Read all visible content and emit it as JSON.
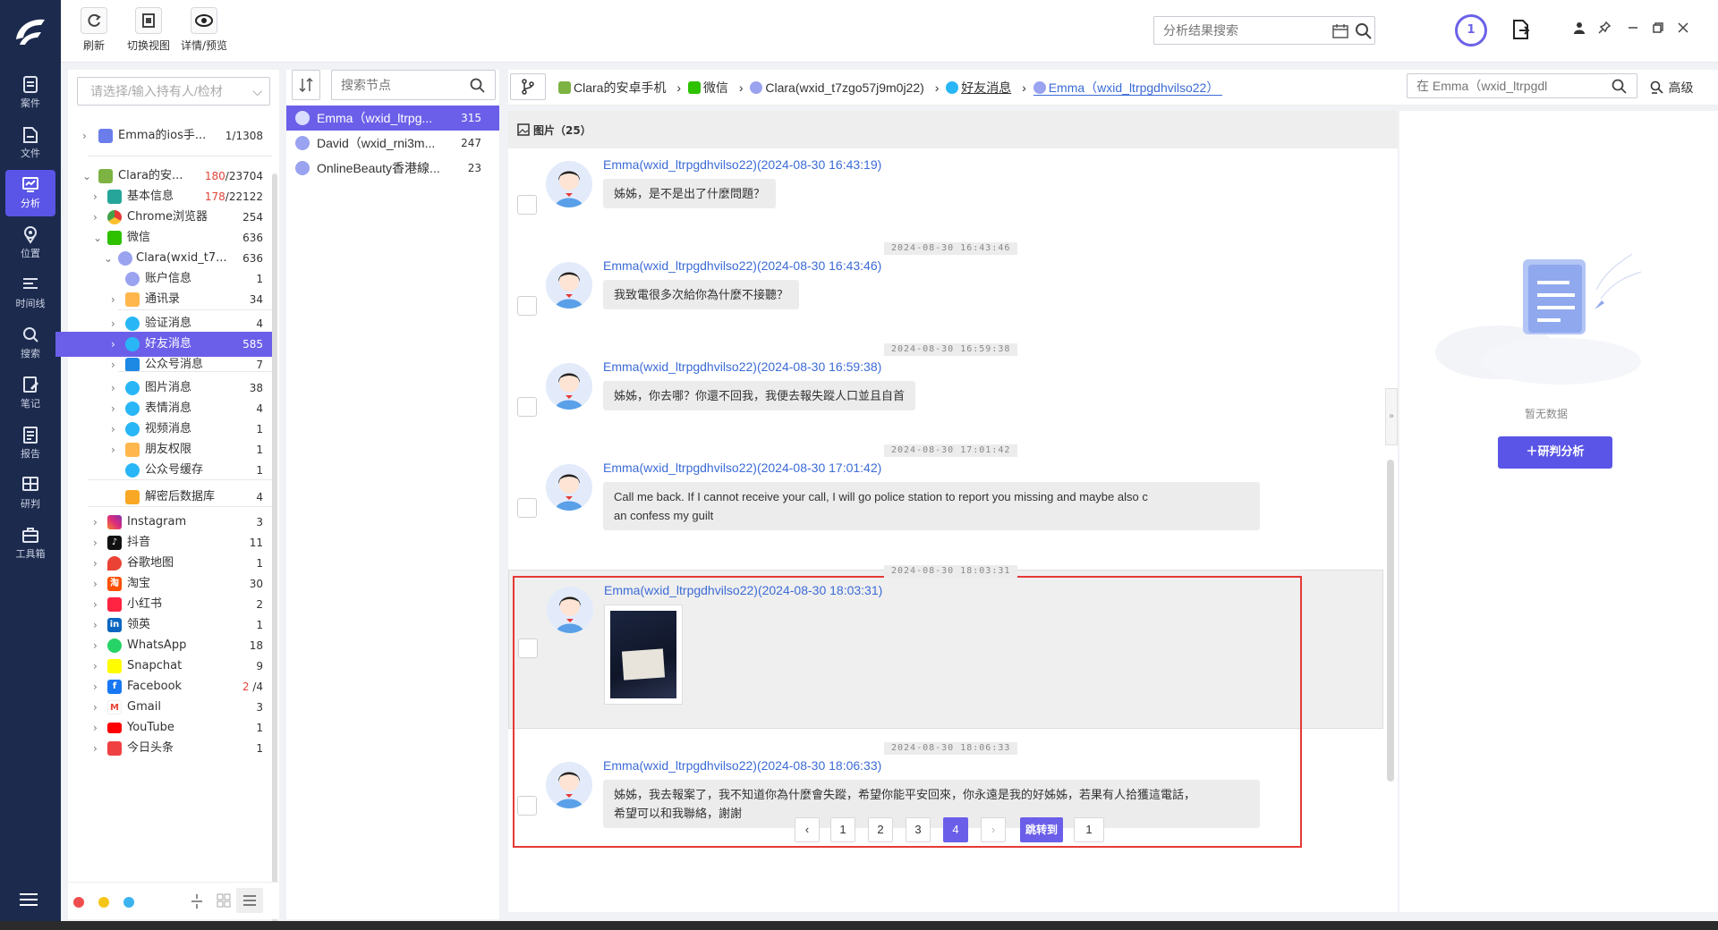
{
  "nav": {
    "items": [
      {
        "label": "案件",
        "icon": "case-icon"
      },
      {
        "label": "文件",
        "icon": "file-icon"
      },
      {
        "label": "分析",
        "icon": "analysis-icon"
      },
      {
        "label": "位置",
        "icon": "location-icon"
      },
      {
        "label": "时间线",
        "icon": "timeline-icon"
      },
      {
        "label": "搜索",
        "icon": "search-icon"
      },
      {
        "label": "笔记",
        "icon": "note-icon"
      },
      {
        "label": "报告",
        "icon": "report-icon"
      },
      {
        "label": "研判",
        "icon": "judge-icon"
      },
      {
        "label": "工具箱",
        "icon": "toolbox-icon"
      }
    ],
    "active_index": 2
  },
  "toolbar": {
    "refresh": "刷新",
    "switch_view": "切换视图",
    "detail_preview": "详情/预览",
    "result_search_placeholder": "分析结果搜索",
    "task_count": "1"
  },
  "tree": {
    "select_placeholder": "请选择/输入持有人/检材",
    "rows": [
      {
        "label": "Emma的ios手...",
        "count": "1/1308"
      },
      {
        "label": "Clara的安...",
        "count_red": "180",
        "count": "/23704"
      },
      {
        "label": "基本信息",
        "count_red": "178",
        "count": "/22122"
      },
      {
        "label": "Chrome浏览器",
        "count": "254"
      },
      {
        "label": "微信",
        "count": "636"
      },
      {
        "label": "Clara(wxid_t7...",
        "count": "636"
      },
      {
        "label": "账户信息",
        "count": "1"
      },
      {
        "label": "通讯录",
        "count": "34"
      },
      {
        "label": "验证消息",
        "count": "4"
      },
      {
        "label": "好友消息",
        "count": "585"
      },
      {
        "label": "公众号消息",
        "count": "7"
      },
      {
        "label": "图片消息",
        "count": "38"
      },
      {
        "label": "表情消息",
        "count": "4"
      },
      {
        "label": "视频消息",
        "count": "1"
      },
      {
        "label": "朋友权限",
        "count": "1"
      },
      {
        "label": "公众号缓存",
        "count": "1"
      },
      {
        "label": "解密后数据库",
        "count": "4"
      },
      {
        "label": "Instagram",
        "count": "3"
      },
      {
        "label": "抖音",
        "count": "11"
      },
      {
        "label": "谷歌地图",
        "count": "1"
      },
      {
        "label": "淘宝",
        "count": "30"
      },
      {
        "label": "小红书",
        "count": "2"
      },
      {
        "label": "领英",
        "count": "1"
      },
      {
        "label": "WhatsApp",
        "count": "18"
      },
      {
        "label": "Snapchat",
        "count": "9"
      },
      {
        "label": "Facebook",
        "count_red": "2",
        "count": "/4"
      },
      {
        "label": "Gmail",
        "count": "3"
      },
      {
        "label": "YouTube",
        "count": "1"
      },
      {
        "label": "今日头条",
        "count": "1"
      }
    ]
  },
  "contacts": {
    "search_placeholder": "搜索节点",
    "items": [
      {
        "name": "Emma（wxid_ltrpg...",
        "count": "315"
      },
      {
        "name": "David（wxid_rni3m...",
        "count": "247"
      },
      {
        "name": "OnlineBeauty香港線...",
        "count": "23"
      }
    ]
  },
  "breadcrumb": {
    "items": [
      "Clara的安卓手机",
      "微信",
      "Clara(wxid_t7zgo57j9m0j22)",
      "好友消息",
      "Emma（wxid_ltrpgdhvilso22）"
    ],
    "search_placeholder": "在 Emma（wxid_ltrpgdl",
    "advanced": "高级"
  },
  "chat": {
    "header": "图片（25）",
    "messages": [
      {
        "sender": "Emma(wxid_ltrpgdhvilso22)(2024-08-30 16:43:19)",
        "text": "姊姊，是不是出了什麼問題？"
      },
      {
        "stamp": "2024-08-30 16:43:46",
        "sender": "Emma(wxid_ltrpgdhvilso22)(2024-08-30 16:43:46)",
        "text": "我致電很多次給你為什麼不接聽？"
      },
      {
        "stamp": "2024-08-30 16:59:38",
        "sender": "Emma(wxid_ltrpgdhvilso22)(2024-08-30 16:59:38)",
        "text": "姊姊，你去哪？你還不回我，我便去報失蹤人口並且自首"
      },
      {
        "stamp": "2024-08-30 17:01:42",
        "sender": "Emma(wxid_ltrpgdhvilso22)(2024-08-30 17:01:42)",
        "text": "Call me back. If I cannot receive your call, I will go police station to report you missing and maybe also c",
        "text2": "an confess my guilt"
      },
      {
        "stamp": "2024-08-30 18:03:31",
        "sender": "Emma(wxid_ltrpgdhvilso22)(2024-08-30 18:03:31)",
        "text": ""
      },
      {
        "stamp": "2024-08-30 18:06:33",
        "sender": "Emma(wxid_ltrpgdhvilso22)(2024-08-30 18:06:33)",
        "text": "姊姊，我去報案了，我不知道你為什麼會失蹤，希望你能平安回來，你永遠是我的好姊姊，若果有人拾獲這電話，",
        "text2": "希望可以和我聯絡，謝謝"
      }
    ]
  },
  "pager": {
    "pages": [
      "1",
      "2",
      "3",
      "4"
    ],
    "current": "4",
    "jump_label": "跳转到",
    "jump_value": "1"
  },
  "right_panel": {
    "empty_text": "暂无数据",
    "analyze_button": "＋研判分析"
  },
  "colors": {
    "accent": "#6b5fe9",
    "nav_bg": "#1c2a4d",
    "link": "#3b6bd6",
    "highlight_box": "#e53935"
  }
}
